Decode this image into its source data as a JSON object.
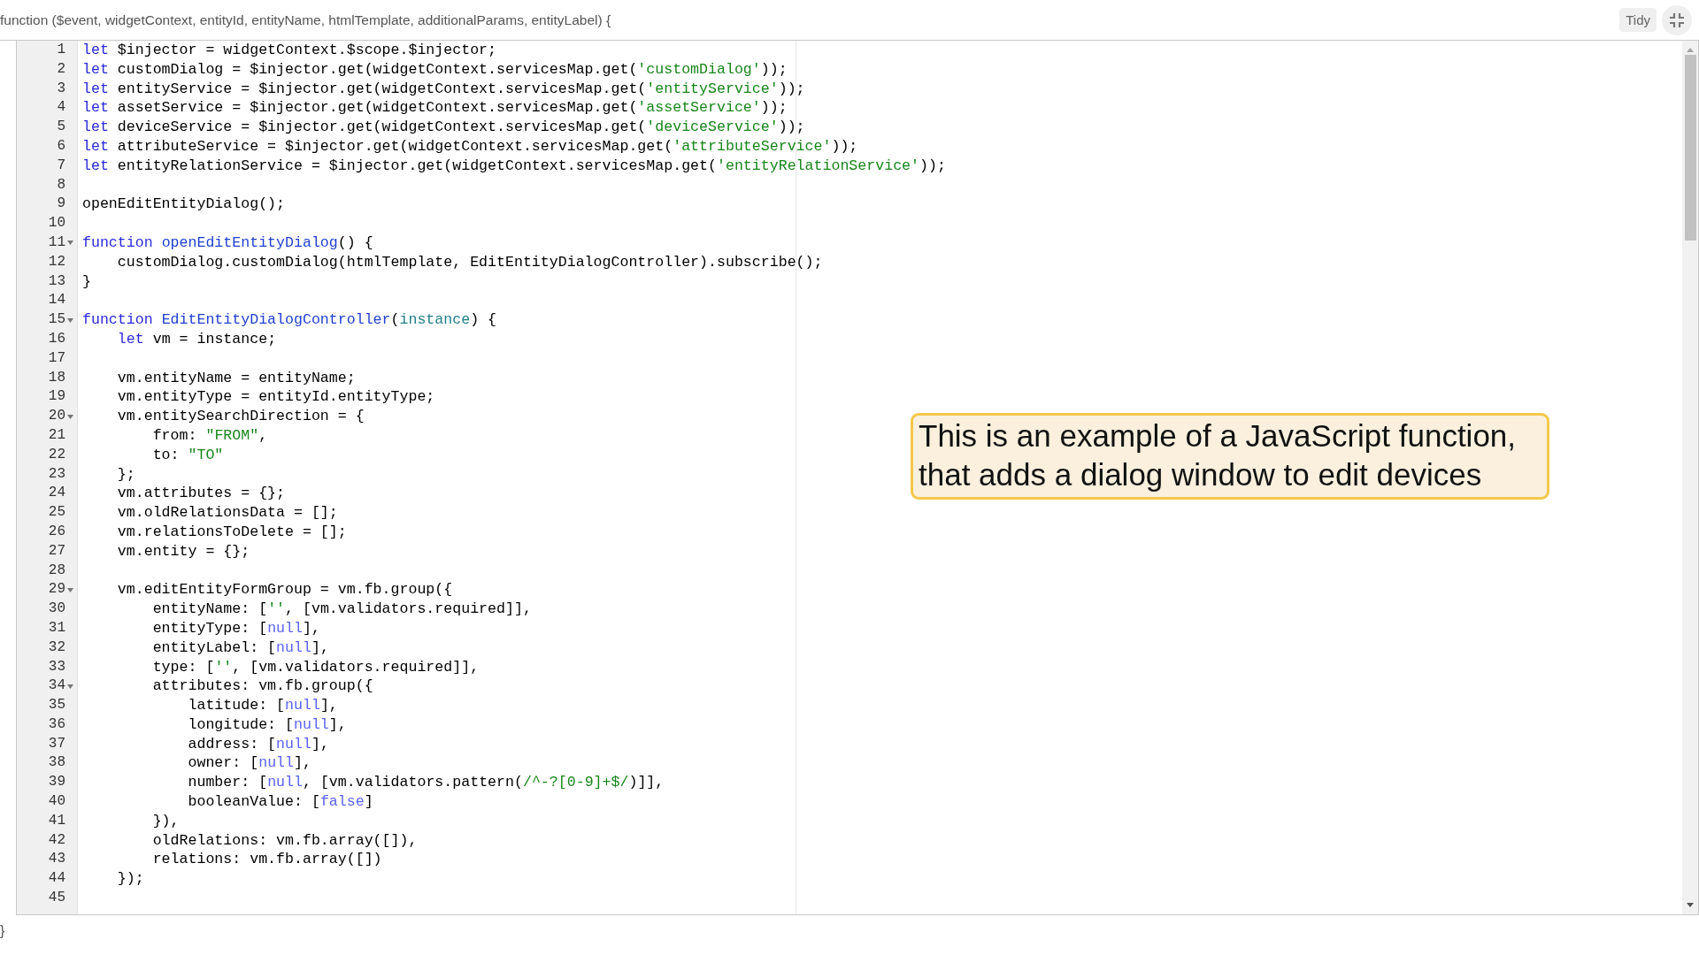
{
  "header": {
    "signature": "function ($event, widgetContext, entityId, entityName, htmlTemplate, additionalParams, entityLabel) {"
  },
  "toolbar": {
    "tidy_button": "Tidy"
  },
  "editor": {
    "lines": [
      {
        "number": "1",
        "foldable": false,
        "tokens": [
          {
            "kind": "keyword",
            "text": "let"
          },
          {
            "kind": "plain",
            "text": " $injector = widgetContext.$scope.$injector;"
          }
        ]
      },
      {
        "number": "2",
        "foldable": false,
        "tokens": [
          {
            "kind": "keyword",
            "text": "let"
          },
          {
            "kind": "plain",
            "text": " customDialog = $injector.get(widgetContext.servicesMap.get("
          },
          {
            "kind": "string",
            "text": "'customDialog'"
          },
          {
            "kind": "plain",
            "text": "));"
          }
        ]
      },
      {
        "number": "3",
        "foldable": false,
        "tokens": [
          {
            "kind": "keyword",
            "text": "let"
          },
          {
            "kind": "plain",
            "text": " entityService = $injector.get(widgetContext.servicesMap.get("
          },
          {
            "kind": "string",
            "text": "'entityService'"
          },
          {
            "kind": "plain",
            "text": "));"
          }
        ]
      },
      {
        "number": "4",
        "foldable": false,
        "tokens": [
          {
            "kind": "keyword",
            "text": "let"
          },
          {
            "kind": "plain",
            "text": " assetService = $injector.get(widgetContext.servicesMap.get("
          },
          {
            "kind": "string",
            "text": "'assetService'"
          },
          {
            "kind": "plain",
            "text": "));"
          }
        ]
      },
      {
        "number": "5",
        "foldable": false,
        "tokens": [
          {
            "kind": "keyword",
            "text": "let"
          },
          {
            "kind": "plain",
            "text": " deviceService = $injector.get(widgetContext.servicesMap.get("
          },
          {
            "kind": "string",
            "text": "'deviceService'"
          },
          {
            "kind": "plain",
            "text": "));"
          }
        ]
      },
      {
        "number": "6",
        "foldable": false,
        "tokens": [
          {
            "kind": "keyword",
            "text": "let"
          },
          {
            "kind": "plain",
            "text": " attributeService = $injector.get(widgetContext.servicesMap.get("
          },
          {
            "kind": "string",
            "text": "'attributeService'"
          },
          {
            "kind": "plain",
            "text": "));"
          }
        ]
      },
      {
        "number": "7",
        "foldable": false,
        "tokens": [
          {
            "kind": "keyword",
            "text": "let"
          },
          {
            "kind": "plain",
            "text": " entityRelationService = $injector.get(widgetContext.servicesMap.get("
          },
          {
            "kind": "string",
            "text": "'entityRelationService'"
          },
          {
            "kind": "plain",
            "text": "));"
          }
        ]
      },
      {
        "number": "8",
        "foldable": false
      },
      {
        "number": "9",
        "foldable": false,
        "tokens": [
          {
            "kind": "plain",
            "text": "openEditEntityDialog();"
          }
        ]
      },
      {
        "number": "10",
        "foldable": false
      },
      {
        "number": "11",
        "foldable": true,
        "tokens": [
          {
            "kind": "keyword",
            "text": "function "
          },
          {
            "kind": "def",
            "text": "openEditEntityDialog"
          },
          {
            "kind": "plain",
            "text": "() {"
          }
        ]
      },
      {
        "number": "12",
        "foldable": false,
        "tokens": [
          {
            "kind": "plain",
            "text": "    customDialog.customDialog(htmlTemplate, EditEntityDialogController).subscribe();"
          }
        ]
      },
      {
        "number": "13",
        "foldable": false,
        "tokens": [
          {
            "kind": "plain",
            "text": "}"
          }
        ]
      },
      {
        "number": "14",
        "foldable": false
      },
      {
        "number": "15",
        "foldable": true,
        "tokens": [
          {
            "kind": "keyword",
            "text": "function "
          },
          {
            "kind": "def",
            "text": "EditEntityDialogController"
          },
          {
            "kind": "plain",
            "text": "("
          },
          {
            "kind": "param",
            "text": "instance"
          },
          {
            "kind": "plain",
            "text": ") {"
          }
        ]
      },
      {
        "number": "16",
        "foldable": false,
        "tokens": [
          {
            "kind": "keyword",
            "text": "    let"
          },
          {
            "kind": "plain",
            "text": " vm = instance;"
          }
        ]
      },
      {
        "number": "17",
        "foldable": false
      },
      {
        "number": "18",
        "foldable": false,
        "tokens": [
          {
            "kind": "plain",
            "text": "    vm.entityName = entityName;"
          }
        ]
      },
      {
        "number": "19",
        "foldable": false,
        "tokens": [
          {
            "kind": "plain",
            "text": "    vm.entityType = entityId.entityType;"
          }
        ]
      },
      {
        "number": "20",
        "foldable": true,
        "tokens": [
          {
            "kind": "plain",
            "text": "    vm.entitySearchDirection = {"
          }
        ]
      },
      {
        "number": "21",
        "foldable": false,
        "tokens": [
          {
            "kind": "plain",
            "text": "        from: "
          },
          {
            "kind": "string",
            "text": "\"FROM\""
          },
          {
            "kind": "plain",
            "text": ","
          }
        ]
      },
      {
        "number": "22",
        "foldable": false,
        "tokens": [
          {
            "kind": "plain",
            "text": "        to: "
          },
          {
            "kind": "string",
            "text": "\"TO\""
          }
        ]
      },
      {
        "number": "23",
        "foldable": false,
        "tokens": [
          {
            "kind": "plain",
            "text": "    };"
          }
        ]
      },
      {
        "number": "24",
        "foldable": false,
        "tokens": [
          {
            "kind": "plain",
            "text": "    vm.attributes = {};"
          }
        ]
      },
      {
        "number": "25",
        "foldable": false,
        "tokens": [
          {
            "kind": "plain",
            "text": "    vm.oldRelationsData = [];"
          }
        ]
      },
      {
        "number": "26",
        "foldable": false,
        "tokens": [
          {
            "kind": "plain",
            "text": "    vm.relationsToDelete = [];"
          }
        ]
      },
      {
        "number": "27",
        "foldable": false,
        "tokens": [
          {
            "kind": "plain",
            "text": "    vm.entity = {};"
          }
        ]
      },
      {
        "number": "28",
        "foldable": false
      },
      {
        "number": "29",
        "foldable": true,
        "tokens": [
          {
            "kind": "plain",
            "text": "    vm.editEntityFormGroup = vm.fb.group({"
          }
        ]
      },
      {
        "number": "30",
        "foldable": false,
        "tokens": [
          {
            "kind": "plain",
            "text": "        entityName: ["
          },
          {
            "kind": "string",
            "text": "''"
          },
          {
            "kind": "plain",
            "text": ", [vm.validators.required]],"
          }
        ]
      },
      {
        "number": "31",
        "foldable": false,
        "tokens": [
          {
            "kind": "plain",
            "text": "        entityType: ["
          },
          {
            "kind": "atom",
            "text": "null"
          },
          {
            "kind": "plain",
            "text": "],"
          }
        ]
      },
      {
        "number": "32",
        "foldable": false,
        "tokens": [
          {
            "kind": "plain",
            "text": "        entityLabel: ["
          },
          {
            "kind": "atom",
            "text": "null"
          },
          {
            "kind": "plain",
            "text": "],"
          }
        ]
      },
      {
        "number": "33",
        "foldable": false,
        "tokens": [
          {
            "kind": "plain",
            "text": "        type: ["
          },
          {
            "kind": "string",
            "text": "''"
          },
          {
            "kind": "plain",
            "text": ", [vm.validators.required]],"
          }
        ]
      },
      {
        "number": "34",
        "foldable": true,
        "tokens": [
          {
            "kind": "plain",
            "text": "        attributes: vm.fb.group({"
          }
        ]
      },
      {
        "number": "35",
        "foldable": false,
        "tokens": [
          {
            "kind": "plain",
            "text": "            latitude: ["
          },
          {
            "kind": "atom",
            "text": "null"
          },
          {
            "kind": "plain",
            "text": "],"
          }
        ]
      },
      {
        "number": "36",
        "foldable": false,
        "tokens": [
          {
            "kind": "plain",
            "text": "            longitude: ["
          },
          {
            "kind": "atom",
            "text": "null"
          },
          {
            "kind": "plain",
            "text": "],"
          }
        ]
      },
      {
        "number": "37",
        "foldable": false,
        "tokens": [
          {
            "kind": "plain",
            "text": "            address: ["
          },
          {
            "kind": "atom",
            "text": "null"
          },
          {
            "kind": "plain",
            "text": "],"
          }
        ]
      },
      {
        "number": "38",
        "foldable": false,
        "tokens": [
          {
            "kind": "plain",
            "text": "            owner: ["
          },
          {
            "kind": "atom",
            "text": "null"
          },
          {
            "kind": "plain",
            "text": "],"
          }
        ]
      },
      {
        "number": "39",
        "foldable": false,
        "tokens": [
          {
            "kind": "plain",
            "text": "            number: ["
          },
          {
            "kind": "atom",
            "text": "null"
          },
          {
            "kind": "plain",
            "text": ", [vm.validators.pattern("
          },
          {
            "kind": "string",
            "text": "/^-?[0-9]+$/"
          },
          {
            "kind": "plain",
            "text": ")]],"
          }
        ]
      },
      {
        "number": "40",
        "foldable": false,
        "tokens": [
          {
            "kind": "plain",
            "text": "            booleanValue: ["
          },
          {
            "kind": "atom",
            "text": "false"
          },
          {
            "kind": "plain",
            "text": "]"
          }
        ]
      },
      {
        "number": "41",
        "foldable": false,
        "tokens": [
          {
            "kind": "plain",
            "text": "        }),"
          }
        ]
      },
      {
        "number": "42",
        "foldable": false,
        "tokens": [
          {
            "kind": "plain",
            "text": "        oldRelations: vm.fb.array([]),"
          }
        ]
      },
      {
        "number": "43",
        "foldable": false,
        "tokens": [
          {
            "kind": "plain",
            "text": "        relations: vm.fb.array([])"
          }
        ]
      },
      {
        "number": "44",
        "foldable": false,
        "tokens": [
          {
            "kind": "plain",
            "text": "    });"
          }
        ]
      },
      {
        "number": "45",
        "foldable": false
      }
    ]
  },
  "footer": {
    "closing": "}"
  },
  "callout": {
    "text": "This is an example of a JavaScript function, that adds a dialog window to edit devices"
  }
}
